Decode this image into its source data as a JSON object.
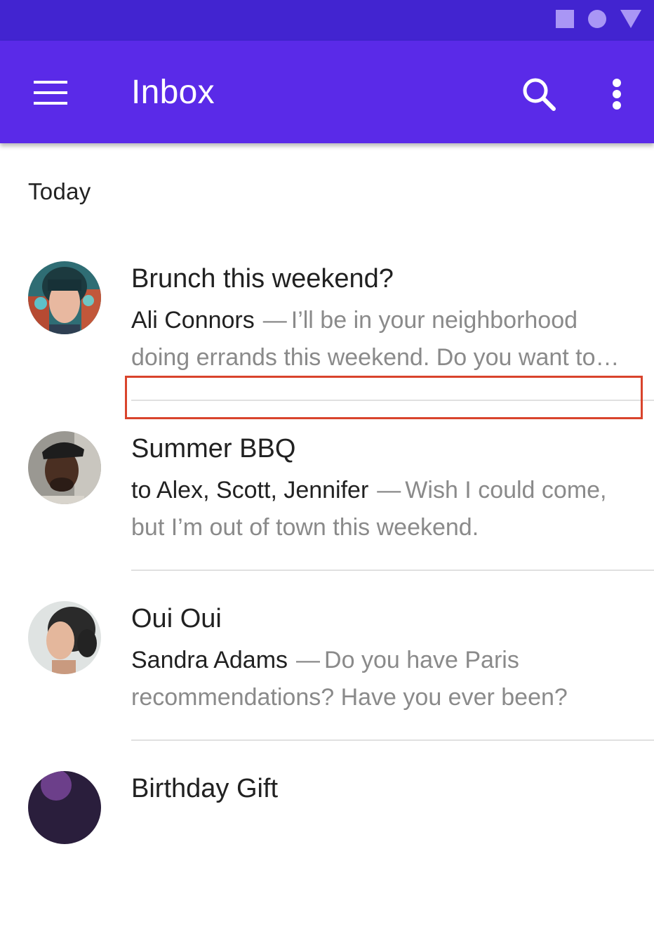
{
  "status_bar": {
    "icons": [
      "square-icon",
      "circle-icon",
      "triangle-icon"
    ],
    "color": "#4224d0"
  },
  "app_bar": {
    "title": "Inbox",
    "color": "#5a2ae8",
    "icons": [
      "menu-icon",
      "search-icon",
      "more-vert-icon"
    ]
  },
  "section": {
    "label": "Today"
  },
  "emails": [
    {
      "subject": "Brunch this weekend?",
      "sender": "Ali Connors",
      "dash": "—",
      "preview": "I’ll be in your neighborhood doing errands this weekend. Do you want to grab brunch?"
    },
    {
      "subject": "Summer BBQ",
      "sender": "to Alex, Scott, Jennifer",
      "dash": "—",
      "preview": "Wish I could come, but I’m out of town this weekend."
    },
    {
      "subject": "Oui Oui",
      "sender": "Sandra Adams",
      "dash": "—",
      "preview": "Do you have Paris recommendations? Have you ever been?"
    },
    {
      "subject": "Birthday Gift",
      "sender": "",
      "dash": "",
      "preview": ""
    }
  ],
  "highlight_color": "#d9442c"
}
